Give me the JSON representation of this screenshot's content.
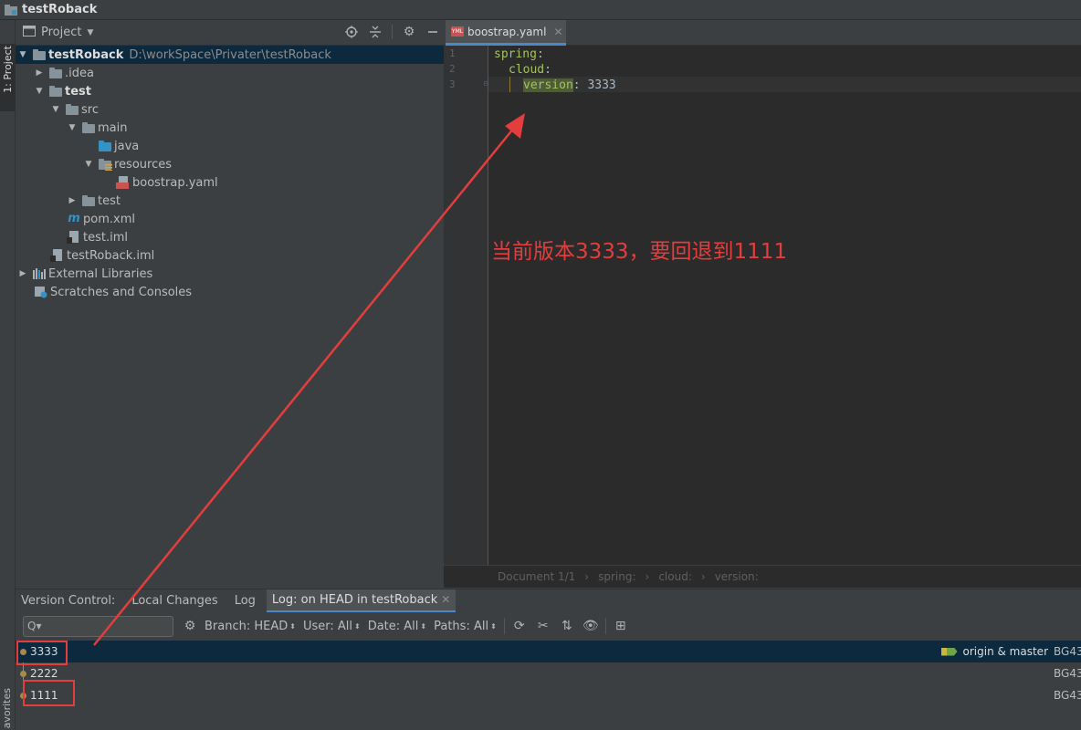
{
  "window": {
    "title": "testRoback"
  },
  "left_strip": {
    "project_tab": "1: Project",
    "favorites_tab": "avorites"
  },
  "project_panel": {
    "selector_label": "Project",
    "tree": [
      {
        "label": "testRoback",
        "path": "D:\\workSpace\\Privater\\testRoback",
        "icon": "module-folder-icon"
      },
      {
        "label": ".idea",
        "icon": "folder-icon"
      },
      {
        "label": "test",
        "icon": "module-folder-icon"
      },
      {
        "label": "src",
        "icon": "folder-icon"
      },
      {
        "label": "main",
        "icon": "folder-icon"
      },
      {
        "label": "java",
        "icon": "source-folder-icon"
      },
      {
        "label": "resources",
        "icon": "resources-folder-icon"
      },
      {
        "label": "boostrap.yaml",
        "icon": "yaml-file-icon"
      },
      {
        "label": "test",
        "icon": "folder-icon"
      },
      {
        "label": "pom.xml",
        "icon": "maven-icon"
      },
      {
        "label": "test.iml",
        "icon": "iml-file-icon"
      },
      {
        "label": "testRoback.iml",
        "icon": "iml-file-icon"
      },
      {
        "label": "External Libraries",
        "icon": "libraries-icon"
      },
      {
        "label": "Scratches and Consoles",
        "icon": "scratches-icon"
      }
    ]
  },
  "editor": {
    "tab_label": "boostrap.yaml",
    "yml_badge": "YML",
    "lines": [
      {
        "num": "1",
        "key": "spring",
        "sep": ":"
      },
      {
        "num": "2",
        "key": "cloud",
        "sep": ":"
      },
      {
        "num": "3",
        "key": "version",
        "sep": ": ",
        "value": "3333"
      }
    ],
    "breadcrumb": [
      "Document 1/1",
      "spring:",
      "cloud:",
      "version:"
    ]
  },
  "annotation_text": "当前版本3333，要回退到1111",
  "version_control": {
    "title": "Version Control:",
    "tabs": [
      "Local Changes",
      "Log",
      "Log: on HEAD in testRoback"
    ],
    "search_placeholder": "Q▾",
    "filters": [
      "Branch: HEAD",
      "User: All",
      "Date: All",
      "Paths: All"
    ],
    "commits": [
      {
        "message": "3333",
        "refs": "origin & master",
        "author": "BG43"
      },
      {
        "message": "2222",
        "refs": "",
        "author": "BG43"
      },
      {
        "message": "1111",
        "refs": "",
        "author": "BG43"
      }
    ]
  },
  "colors": {
    "annotation": "#e33d3d",
    "selection": "#0d293e",
    "accent": "#4a88c7"
  }
}
